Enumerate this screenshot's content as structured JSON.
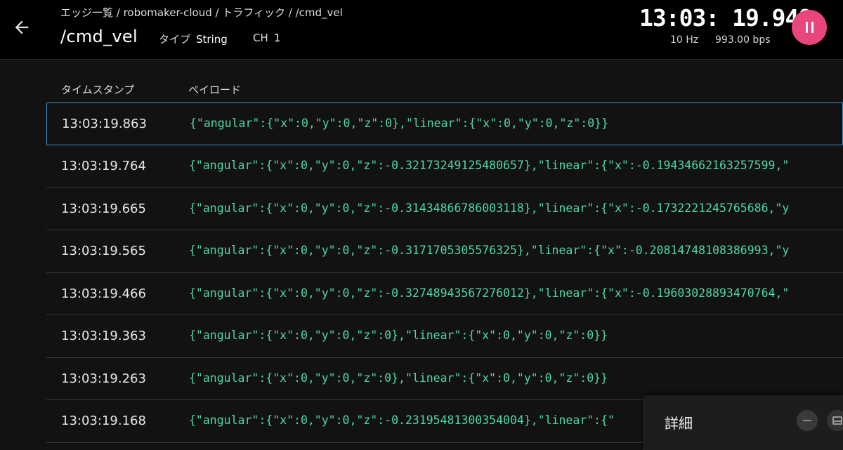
{
  "header": {
    "breadcrumb": "エッジ一覧 / robomaker-cloud / トラフィック / /cmd_vel",
    "title": "/cmd_vel",
    "type_label": "タイプ",
    "type_value": "String",
    "ch_label": "CH",
    "ch_value": "1",
    "clock": "13:03: 19.948",
    "rate_hz": "10 Hz",
    "rate_bps": "993.00 bps",
    "back_icon": "arrow-left-icon",
    "pause_icon": "pause-icon",
    "accent_color": "#e8467c"
  },
  "table": {
    "columns": [
      "タイムスタンプ",
      "ペイロード"
    ],
    "payload_color": "#4ed6a8",
    "selected_border_color": "#3d8ec9",
    "rows": [
      {
        "timestamp": "13:03:19.863",
        "payload": "{\"angular\":{\"x\":0,\"y\":0,\"z\":0},\"linear\":{\"x\":0,\"y\":0,\"z\":0}}"
      },
      {
        "timestamp": "13:03:19.764",
        "payload": "{\"angular\":{\"x\":0,\"y\":0,\"z\":-0.32173249125480657},\"linear\":{\"x\":-0.19434662163257599,\""
      },
      {
        "timestamp": "13:03:19.665",
        "payload": "{\"angular\":{\"x\":0,\"y\":0,\"z\":-0.31434866786003118},\"linear\":{\"x\":-0.1732221245765686,\"y"
      },
      {
        "timestamp": "13:03:19.565",
        "payload": "{\"angular\":{\"x\":0,\"y\":0,\"z\":-0.3171705305576325},\"linear\":{\"x\":-0.20814748108386993,\"y"
      },
      {
        "timestamp": "13:03:19.466",
        "payload": "{\"angular\":{\"x\":0,\"y\":0,\"z\":-0.32748943567276012},\"linear\":{\"x\":-0.19603028893470764,\""
      },
      {
        "timestamp": "13:03:19.363",
        "payload": "{\"angular\":{\"x\":0,\"y\":0,\"z\":0},\"linear\":{\"x\":0,\"y\":0,\"z\":0}}"
      },
      {
        "timestamp": "13:03:19.263",
        "payload": "{\"angular\":{\"x\":0,\"y\":0,\"z\":0},\"linear\":{\"x\":0,\"y\":0,\"z\":0}}"
      },
      {
        "timestamp": "13:03:19.168",
        "payload": "{\"angular\":{\"x\":0,\"y\":0,\"z\":-0.23195481300354004},\"linear\":{\""
      }
    ]
  },
  "detail_panel": {
    "title": "詳細",
    "minimize_icon": "minimize-icon",
    "maximize_icon": "maximize-icon"
  }
}
